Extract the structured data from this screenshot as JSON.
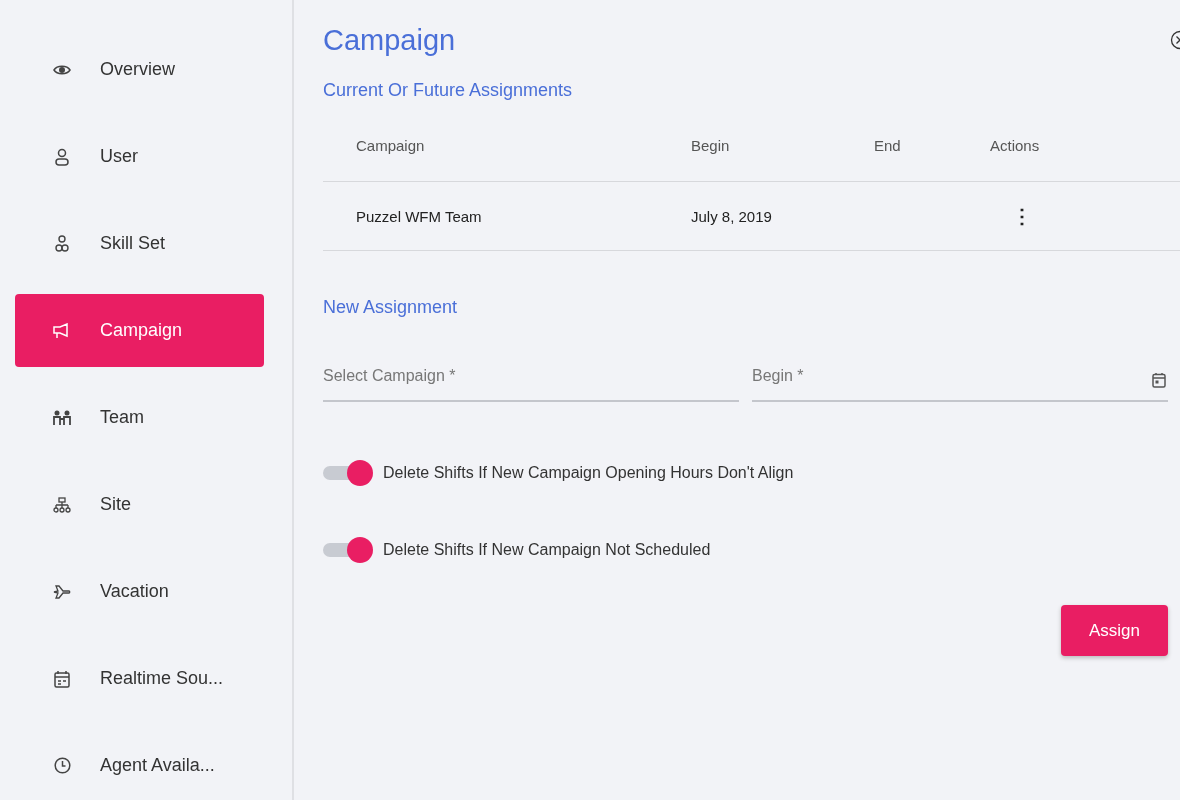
{
  "sidebar": {
    "items": [
      {
        "label": "Overview",
        "selected": false
      },
      {
        "label": "User",
        "selected": false
      },
      {
        "label": "Skill Set",
        "selected": false
      },
      {
        "label": "Campaign",
        "selected": true
      },
      {
        "label": "Team",
        "selected": false
      },
      {
        "label": "Site",
        "selected": false
      },
      {
        "label": "Vacation",
        "selected": false
      },
      {
        "label": "Realtime Sou...",
        "selected": false
      },
      {
        "label": "Agent Availa...",
        "selected": false
      }
    ]
  },
  "panel": {
    "title": "Campaign",
    "current_section": {
      "title": "Current Or Future Assignments",
      "table": {
        "columns": [
          "Campaign",
          "Begin",
          "End",
          "Actions"
        ],
        "rows": [
          {
            "campaign": "Puzzel WFM Team",
            "begin": "July 8, 2019",
            "actions": "⋮"
          }
        ]
      }
    },
    "new_section": {
      "title": "New Assignment",
      "fields": [
        {
          "kind": "select",
          "placeholder": "Select Campaign *"
        },
        {
          "kind": "date",
          "placeholder": "Begin *"
        }
      ],
      "toggles": [
        {
          "label": "Delete Shifts If New Campaign Opening Hours Don't Align",
          "on": true
        },
        {
          "label": "Delete Shifts If New Campaign Not Scheduled",
          "on": true
        }
      ],
      "button": "Assign"
    }
  }
}
